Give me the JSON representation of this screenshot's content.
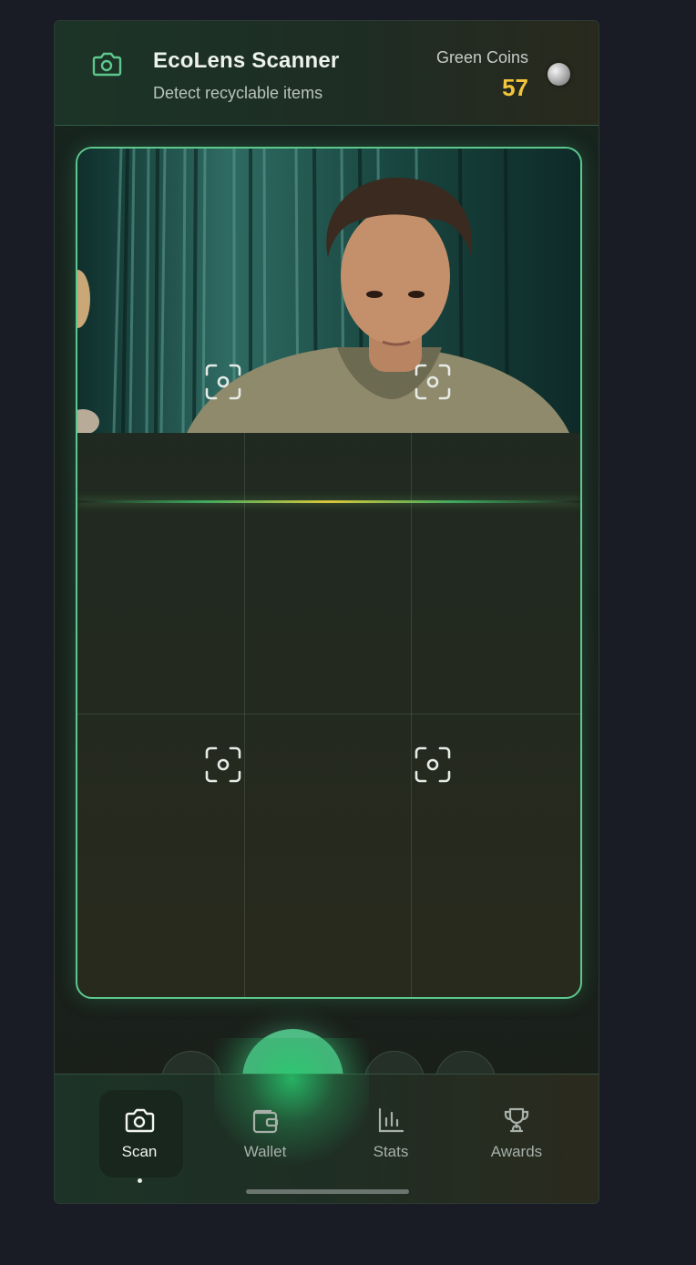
{
  "header": {
    "title": "EcoLens Scanner",
    "subtitle": "Detect recyclable items",
    "coins_label": "Green Coins",
    "coins_value": "57",
    "camera_icon": "camera-icon",
    "coin_icon": "coin-icon"
  },
  "nav": {
    "items": [
      {
        "label": "Scan",
        "icon": "camera-icon",
        "active": true
      },
      {
        "label": "Wallet",
        "icon": "wallet-icon",
        "active": false
      },
      {
        "label": "Stats",
        "icon": "bar-chart-icon",
        "active": false
      },
      {
        "label": "Awards",
        "icon": "trophy-icon",
        "active": false
      }
    ]
  },
  "colors": {
    "accent": "#5cc88d",
    "coins": "#f2c53a",
    "background": "#191c25"
  }
}
